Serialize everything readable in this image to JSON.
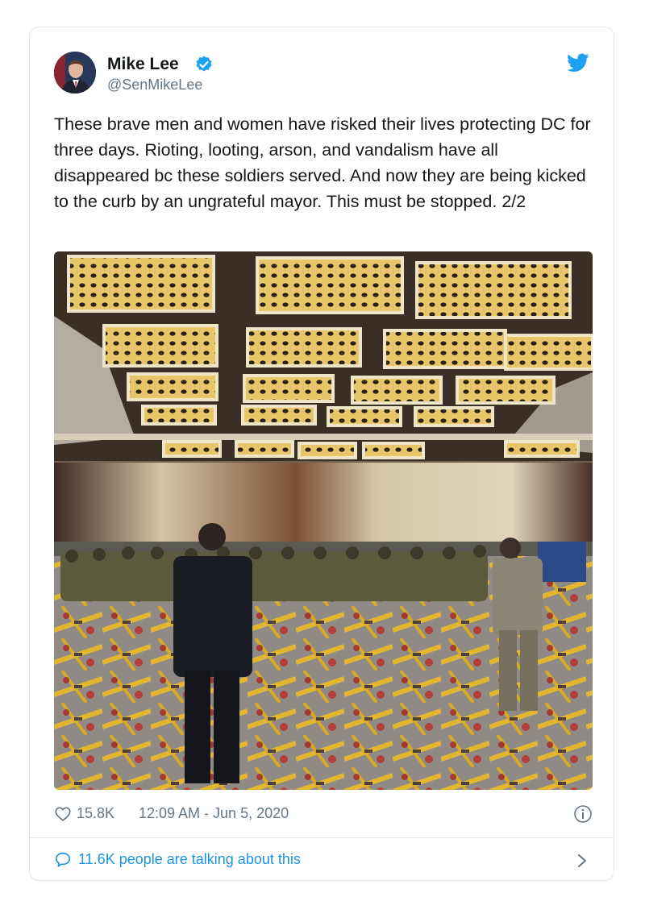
{
  "tweet": {
    "display_name": "Mike Lee",
    "handle": "@SenMikeLee",
    "text": "These brave men and women have risked their lives protecting DC for three days. Rioting, looting, arson, and vandalism have all disappeared bc these soldiers served. And now they are being kicked to the curb by an ungrateful mayor. This must be stopped. 2/2",
    "likes": "15.8K",
    "timestamp": "12:09 AM - Jun 5, 2020",
    "talking_label": "11.6K people are talking about this"
  },
  "icons": {
    "verified": "verified-badge-icon",
    "brand": "twitter-bird-icon",
    "like": "heart-icon",
    "info": "info-icon",
    "reply": "speech-bubble-icon",
    "chevron": "chevron-right-icon"
  },
  "colors": {
    "brand_blue": "#1da1f2",
    "link_blue": "#1b95e0",
    "muted": "#657786",
    "border": "#e1e8ed"
  }
}
